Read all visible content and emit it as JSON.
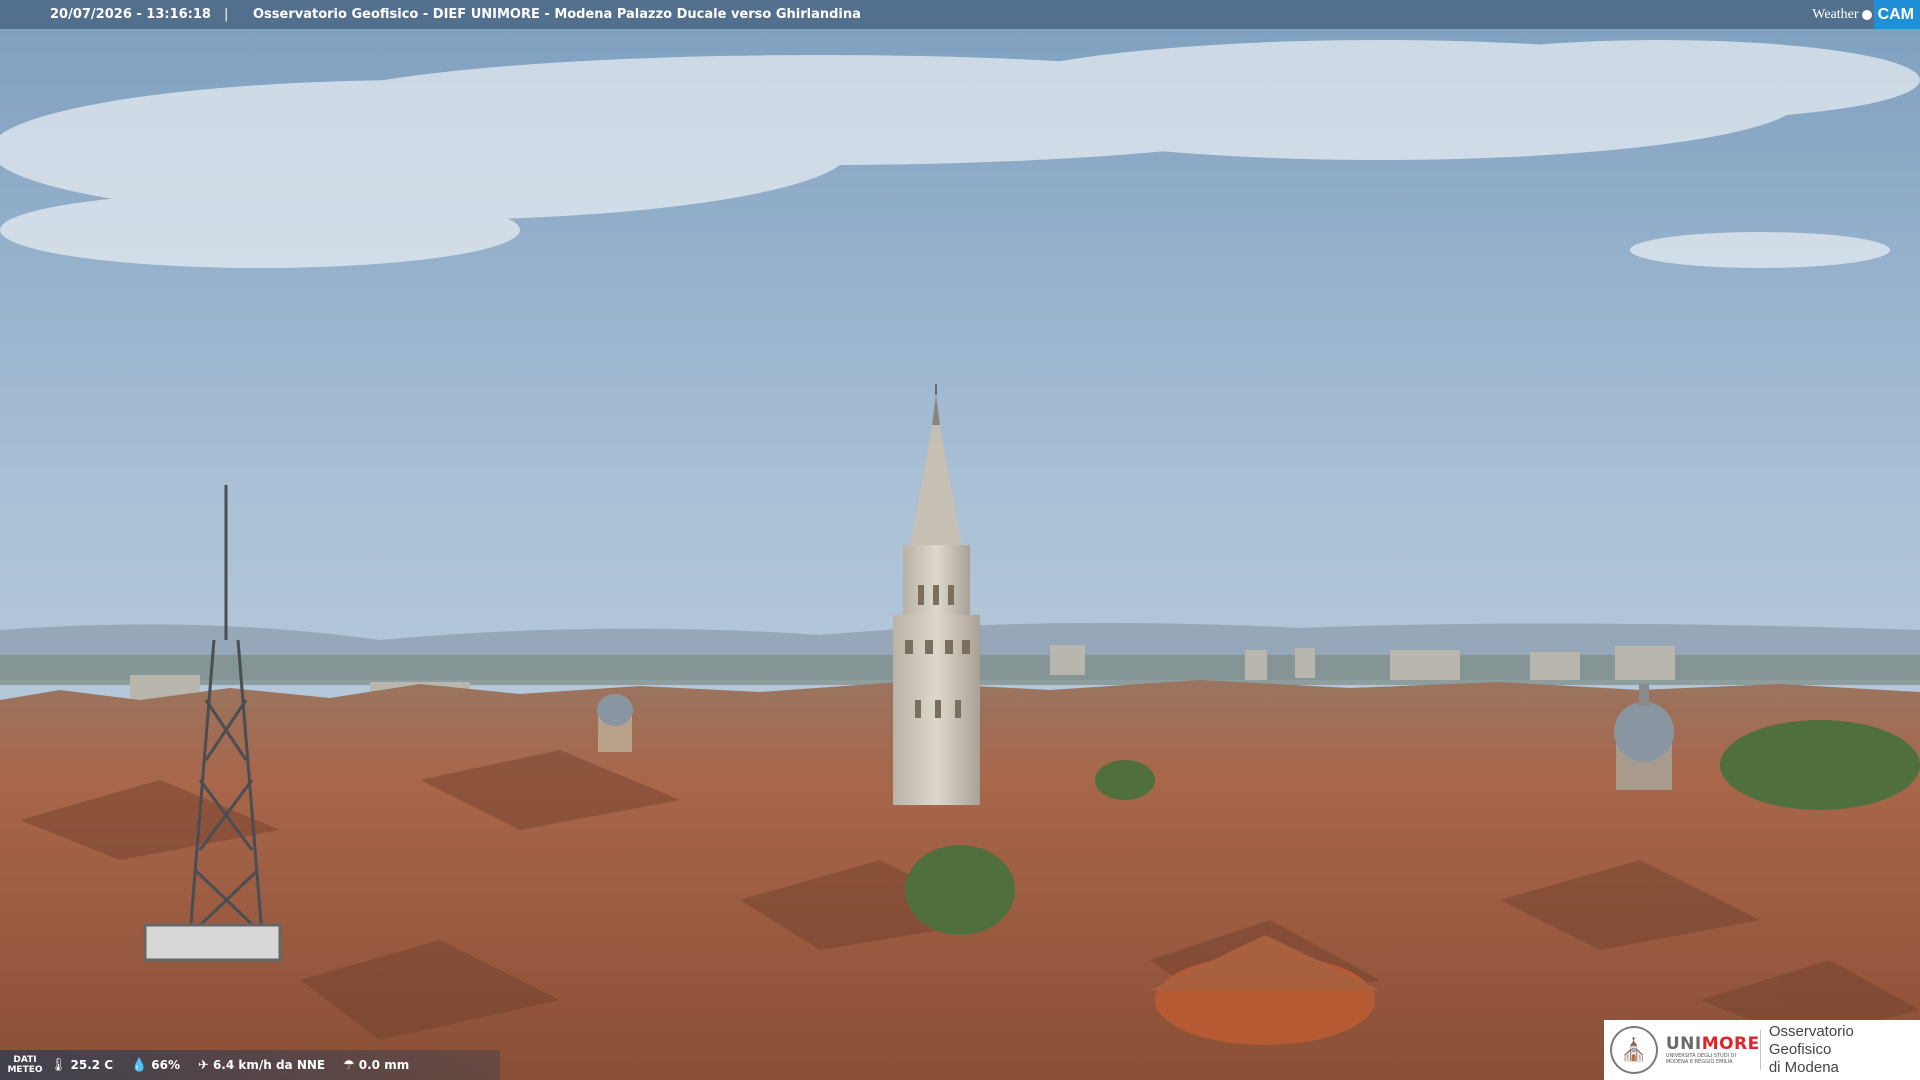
{
  "header": {
    "timestamp": "20/07/2026 - 13:16:18",
    "separator": "|",
    "caption": "Osservatorio Geofisico - DIEF UNIMORE - Modena Palazzo Ducale verso Ghirlandina"
  },
  "logo": {
    "weather": "Weather",
    "cam": "CAM"
  },
  "meteo": {
    "label_line1": "DATI",
    "label_line2": "METEO",
    "temperature": "25.2 C",
    "humidity": "66%",
    "wind": "6.4 km/h da NNE",
    "rain": "0.0 mm",
    "icons": {
      "temperature": "thermometer-icon",
      "humidity": "droplet-icon",
      "wind": "wind-icon",
      "rain": "rain-icon"
    }
  },
  "brand": {
    "unimore_part1": "UNI",
    "unimore_part2": "MORE",
    "university_line1": "UNIVERSITÀ DEGLI STUDI DI",
    "university_line2": "MODENA E REGGIO EMILIA",
    "observatory_line1": "Osservatorio Geofisico",
    "observatory_line2": "di Modena"
  },
  "colors": {
    "sky": "#a9c0d6",
    "roofs": "#a5674a",
    "tower": "#cfc8bb",
    "accent_red": "#e2232a",
    "cam_blue": "#1f8fd8"
  }
}
